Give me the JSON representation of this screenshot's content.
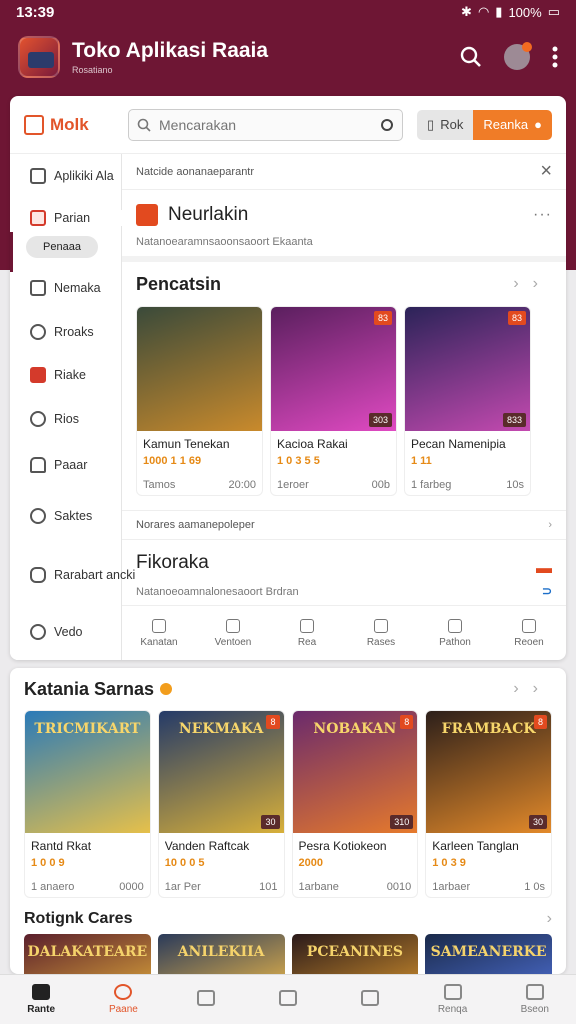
{
  "status": {
    "time": "13:39",
    "battery": "100%"
  },
  "appbar": {
    "title": "Toko Aplikasi Raaia",
    "subtitle": "Rosatiano"
  },
  "brand": {
    "name": "Molk"
  },
  "search": {
    "placeholder": "Mencarakan"
  },
  "buttons": {
    "login": "Rok",
    "register": "Reanka"
  },
  "sidebar": {
    "items": [
      {
        "label": "Aplikiki Ala",
        "icon": "home-icon"
      },
      {
        "label": "Parian",
        "icon": "grid-icon"
      },
      {
        "label": "Nemaka",
        "icon": "picture-icon"
      },
      {
        "label": "Rroaks",
        "icon": "clock-icon"
      },
      {
        "label": "Riake",
        "icon": "mail-icon"
      },
      {
        "label": "Rios",
        "icon": "chat-icon"
      },
      {
        "label": "Paaar",
        "icon": "bag-icon"
      },
      {
        "label": "Saktes",
        "icon": "settings-icon"
      },
      {
        "label": "Rarabart ancki",
        "icon": "message-icon"
      },
      {
        "label": "Vedo",
        "icon": "help-icon"
      }
    ],
    "sub_chip": "Penaaa"
  },
  "notice": {
    "text": "Natcide aonanaeparantr"
  },
  "feature": {
    "title": "Neurlakin",
    "subtitle": "Natanoearamnsaoonsaoort Ekaanta"
  },
  "section1": {
    "title": "Pencatsin",
    "cards": [
      {
        "name": "Kamun Tenekan",
        "price": "1000 1 1 69",
        "meta_left": "Tamos",
        "meta_right": "20:00",
        "tag": "",
        "tag2": "",
        "c1": "#3a4a3a",
        "c2": "#c98a2c"
      },
      {
        "name": "Kacioa Rakai",
        "price": "1 0 3 5 5",
        "meta_left": "1eroer",
        "meta_right": "00b",
        "tag": "83",
        "tag2": "303",
        "c1": "#5a1f5e",
        "c2": "#e04ac2"
      },
      {
        "name": "Pecan Namenipia",
        "price": "1 11",
        "meta_left": "1 farbeg",
        "meta_right": "10s",
        "tag": "83",
        "tag2": "833",
        "c1": "#2b2358",
        "c2": "#c44ab0"
      }
    ]
  },
  "notice2": {
    "text": "Norares aamanepoleper"
  },
  "feature2": {
    "title": "Fikoraka",
    "subtitle": "Natanoeoamnalonesaoort Brdran"
  },
  "inner_nav": [
    "Kanatan",
    "Ventoen",
    "Rea",
    "Rases",
    "Pathon",
    "Reoen"
  ],
  "section2": {
    "title": "Katania Sarnas",
    "cards": [
      {
        "name": "Rantd Rkat",
        "price": "1 0 0 9",
        "meta_left": "1 anaero",
        "meta_right": "0000",
        "art": "TRICMIKART",
        "tag": "",
        "tag2": "",
        "c1": "#2a7ab8",
        "c2": "#e6c04a"
      },
      {
        "name": "Vanden Raftcak",
        "price": "10 0 0 5",
        "meta_left": "1ar Per",
        "meta_right": "101",
        "art": "NEKMAKA",
        "tag": "8",
        "tag2": "30",
        "c1": "#243a68",
        "c2": "#d8b03a"
      },
      {
        "name": "Pesra Kotiokeon",
        "price": "2000",
        "meta_left": "1arbane",
        "meta_right": "0010",
        "art": "NOBAKAN",
        "tag": "8",
        "tag2": "310",
        "c1": "#6a2a6c",
        "c2": "#e67a2c"
      },
      {
        "name": "Karleen Tanglan",
        "price": "1 0 3 9",
        "meta_left": "1arbaer",
        "meta_right": "1 0s",
        "art": "FRAMBACK",
        "tag": "8",
        "tag2": "30",
        "c1": "#2c1f1a",
        "c2": "#e38a2a"
      }
    ]
  },
  "section3": {
    "title": "Rotignk Cares",
    "thumbs": [
      {
        "art": "DALAKATEARE",
        "c1": "#5a1f2c",
        "c2": "#d6a03a"
      },
      {
        "art": "ANILEKIIA",
        "c1": "#2a3a5a",
        "c2": "#e6b44a"
      },
      {
        "art": "PCEANINES",
        "c1": "#2a1a1a",
        "c2": "#c98a2c"
      },
      {
        "art": "SAMEANERKE",
        "c1": "#1a2a4a",
        "c2": "#4a6aca"
      }
    ]
  },
  "bottom_nav": [
    "Rante",
    "Paane",
    "",
    "",
    "",
    "Renqa",
    "Bseon"
  ]
}
